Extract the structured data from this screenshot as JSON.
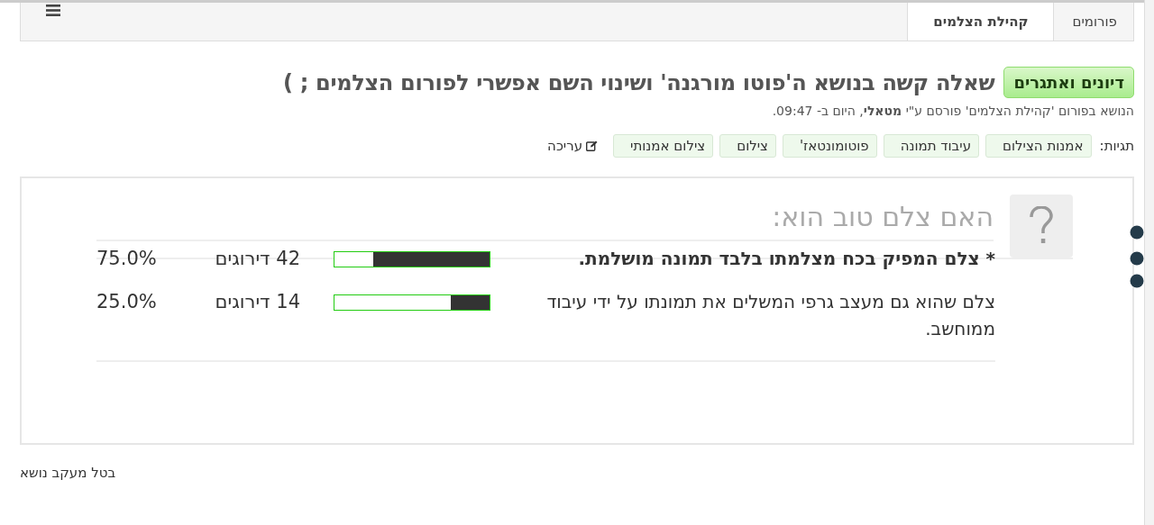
{
  "breadcrumb": [
    {
      "label": "פורומים",
      "current": false
    },
    {
      "label": "קהילת הצלמים",
      "current": true
    }
  ],
  "thread": {
    "prefix": "דיונים ואתגרים",
    "title": "שאלה קשה בנושא ה'פוטו מורגנה' ושינוי השם אפשרי לפורום הצלמים ; )",
    "meta": "הנושא בפורום 'קהילת הצלמים' פורסם ע\"י **מטאלי**, היום ב- 09:47."
  },
  "tags": {
    "label": "תגיות:",
    "items": [
      "אמנות הצילום",
      "עיבוד תמונה",
      "פוטומונטאז'",
      "צילום",
      "צילום אמנותי"
    ],
    "edit": "עריכה"
  },
  "poll": {
    "question": "האם צלם טוב הוא:",
    "options": [
      {
        "text": "* צלם המפיק בכח מצלמתו בלבד תמונה מושלמת.",
        "voted": true,
        "level": 0.75,
        "votes": "42 דירוגים",
        "percent": "75.0%"
      },
      {
        "text": "צלם שהוא גם מעצב גרפי המשלים את תמונתו על ידי עיבוד ממוחשב.",
        "voted": false,
        "level": 0.25,
        "votes": "14 דירוגים",
        "percent": "25.0%"
      }
    ]
  },
  "unwatch": "בטל מעקב נושא"
}
